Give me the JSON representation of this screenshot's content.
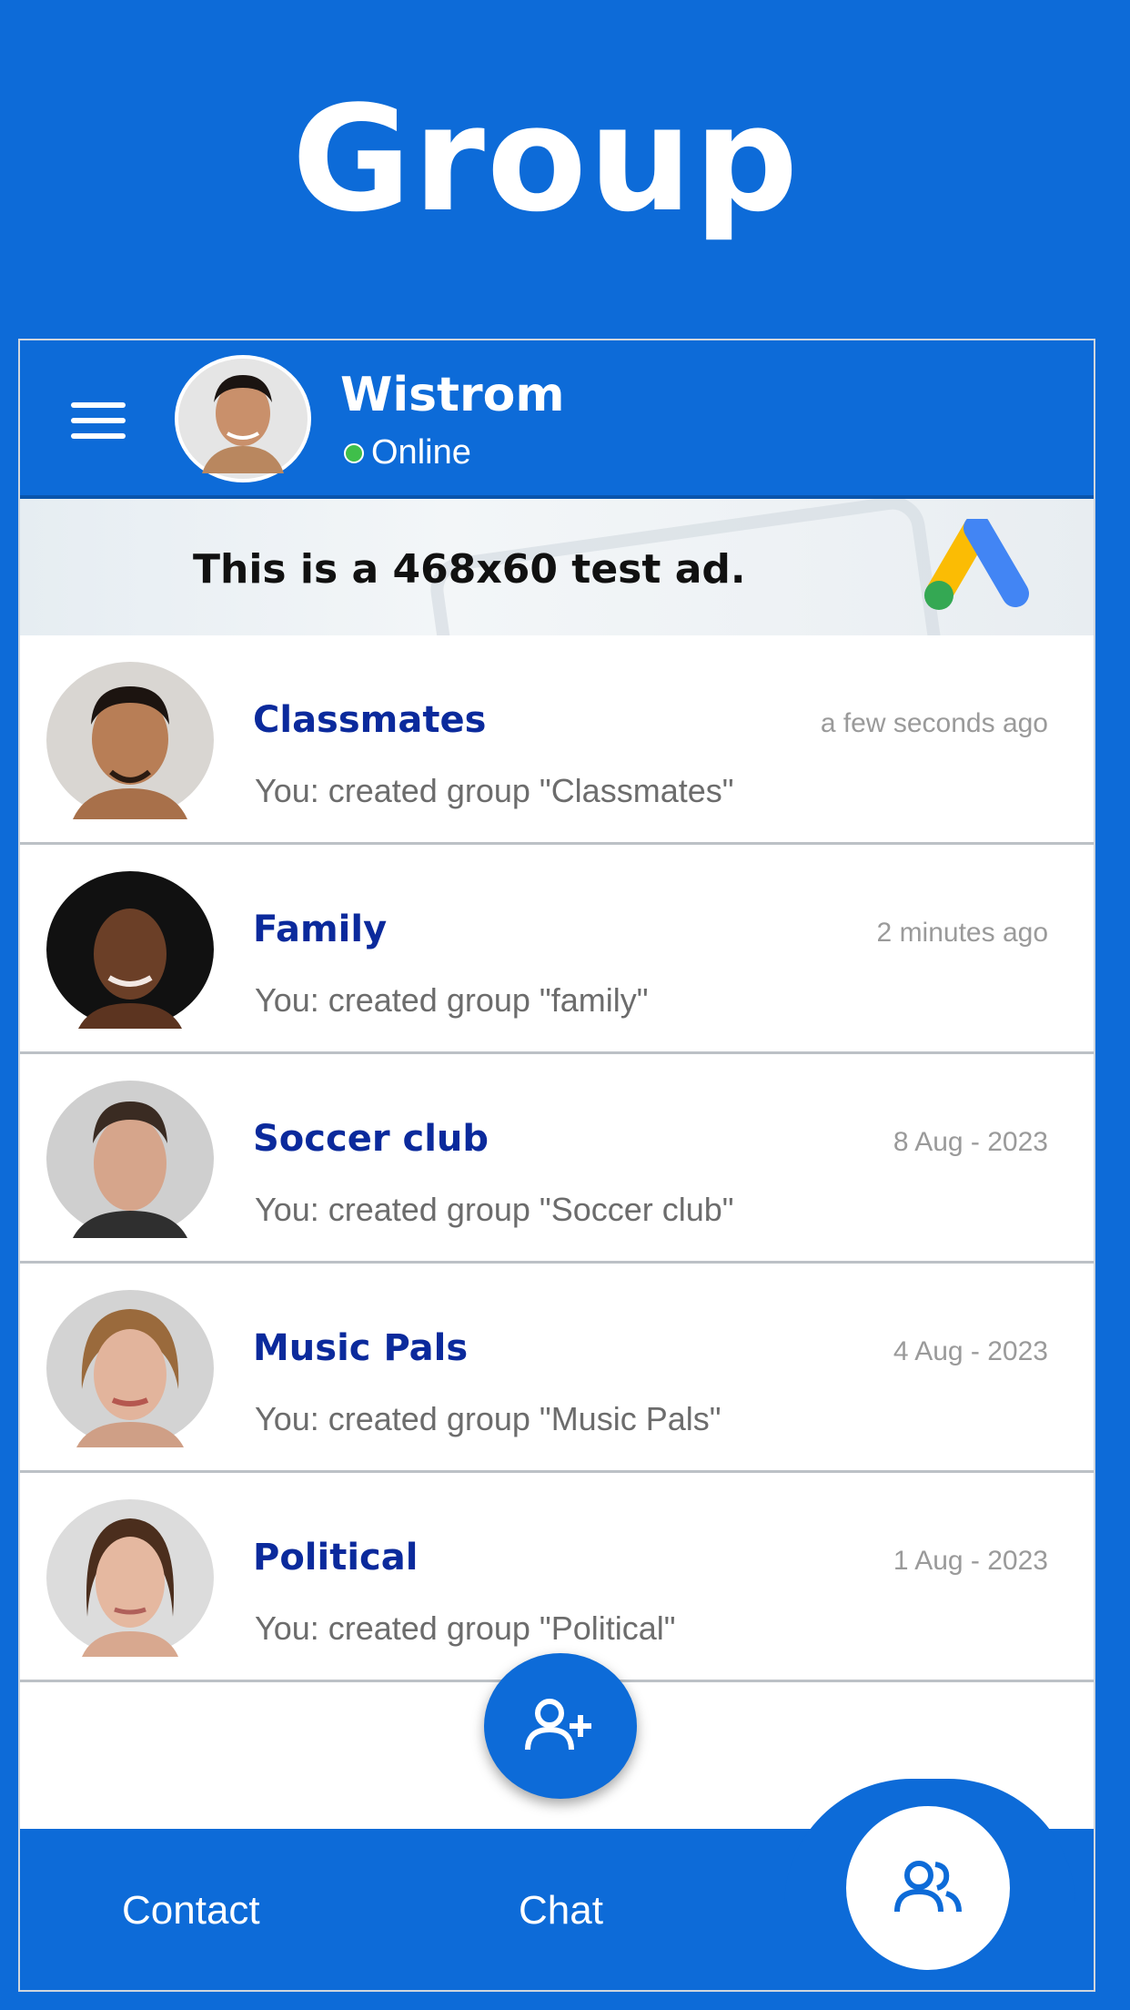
{
  "promo": {
    "title": "Group"
  },
  "colors": {
    "brand": "#0d6bd8",
    "group_name": "#0b2a9c",
    "online": "#3fbf4a"
  },
  "header": {
    "menu_icon": "hamburger-icon",
    "user_name": "Wistrom",
    "status": "Online"
  },
  "ad": {
    "text": "This is a 468x60 test ad.",
    "logo_icon": "google-ads-logo"
  },
  "groups": [
    {
      "name": "Classmates",
      "time": "a few seconds ago",
      "message": "You: created group \"Classmates\""
    },
    {
      "name": "Family",
      "time": "2 minutes ago",
      "message": "You: created group \"family\""
    },
    {
      "name": "Soccer club",
      "time": "8 Aug - 2023",
      "message": "You: created group \"Soccer club\""
    },
    {
      "name": "Music Pals",
      "time": "4 Aug - 2023",
      "message": "You: created group \"Music Pals\""
    },
    {
      "name": "Political",
      "time": "1 Aug - 2023",
      "message": "You: created group \"Political\""
    }
  ],
  "fab": {
    "icon": "add-user-icon"
  },
  "bottom_nav": {
    "contact": "Contact",
    "chat": "Chat",
    "group_icon": "group-icon"
  }
}
